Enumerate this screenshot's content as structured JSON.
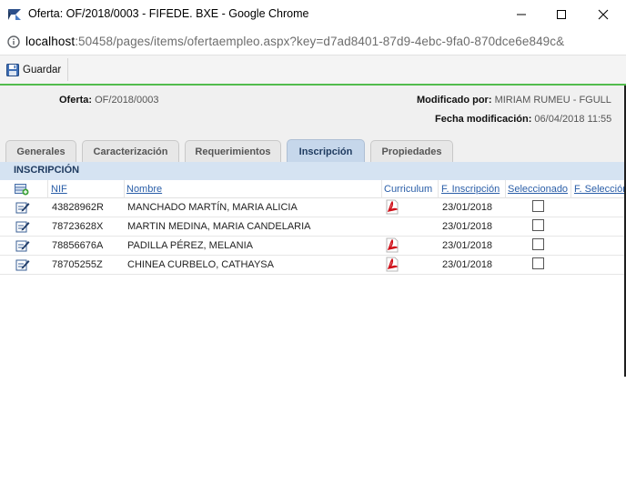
{
  "window": {
    "title": "Oferta: OF/2018/0003 - FIFEDE. BXE - Google Chrome",
    "url_host": "localhost",
    "url_rest": ":50458/pages/items/ofertaempleo.aspx?key=d7ad8401-87d9-4ebc-9fa0-870dce6e849c&"
  },
  "toolbar": {
    "save_label": "Guardar"
  },
  "info": {
    "oferta_label": "Oferta:",
    "oferta_value": "OF/2018/0003",
    "modificado_label": "Modificado por:",
    "modificado_value": "MIRIAM RUMEU - FGULL",
    "fecha_label": "Fecha modificación:",
    "fecha_value": "06/04/2018 11:55"
  },
  "tabs": [
    {
      "label": "Generales"
    },
    {
      "label": "Caracterización"
    },
    {
      "label": "Requerimientos"
    },
    {
      "label": "Inscripción"
    },
    {
      "label": "Propiedades"
    }
  ],
  "section_title": "INSCRIPCIÓN",
  "table": {
    "columns": [
      "NIF",
      "Nombre",
      "Curriculum",
      "F. Inscripción",
      "Seleccionado",
      "F. Selección"
    ],
    "rows": [
      {
        "nif": "43828962R",
        "nombre": "MANCHADO MARTÍN, MARIA ALICIA",
        "curriculum": true,
        "fecha": "23/01/2018",
        "seleccionado": false
      },
      {
        "nif": "78723628X",
        "nombre": "MARTIN MEDINA, MARIA CANDELARIA",
        "curriculum": false,
        "fecha": "23/01/2018",
        "seleccionado": false
      },
      {
        "nif": "78856676A",
        "nombre": "PADILLA PÉREZ, MELANIA",
        "curriculum": true,
        "fecha": "23/01/2018",
        "seleccionado": false
      },
      {
        "nif": "78705255Z",
        "nombre": "CHINEA CURBELO, CATHAYSA",
        "curriculum": true,
        "fecha": "23/01/2018",
        "seleccionado": false
      }
    ]
  },
  "colors": {
    "accent_green": "#52bc4d",
    "tab_active": "#c6d7eb",
    "link": "#2a5ea8",
    "section": "#d5e3f2"
  },
  "icons": {
    "app": "app-logo-icon",
    "info": "info-icon",
    "save": "floppy-disk-icon",
    "edit": "edit-pencil-icon",
    "pdf": "pdf-file-icon",
    "add": "add-record-icon"
  }
}
